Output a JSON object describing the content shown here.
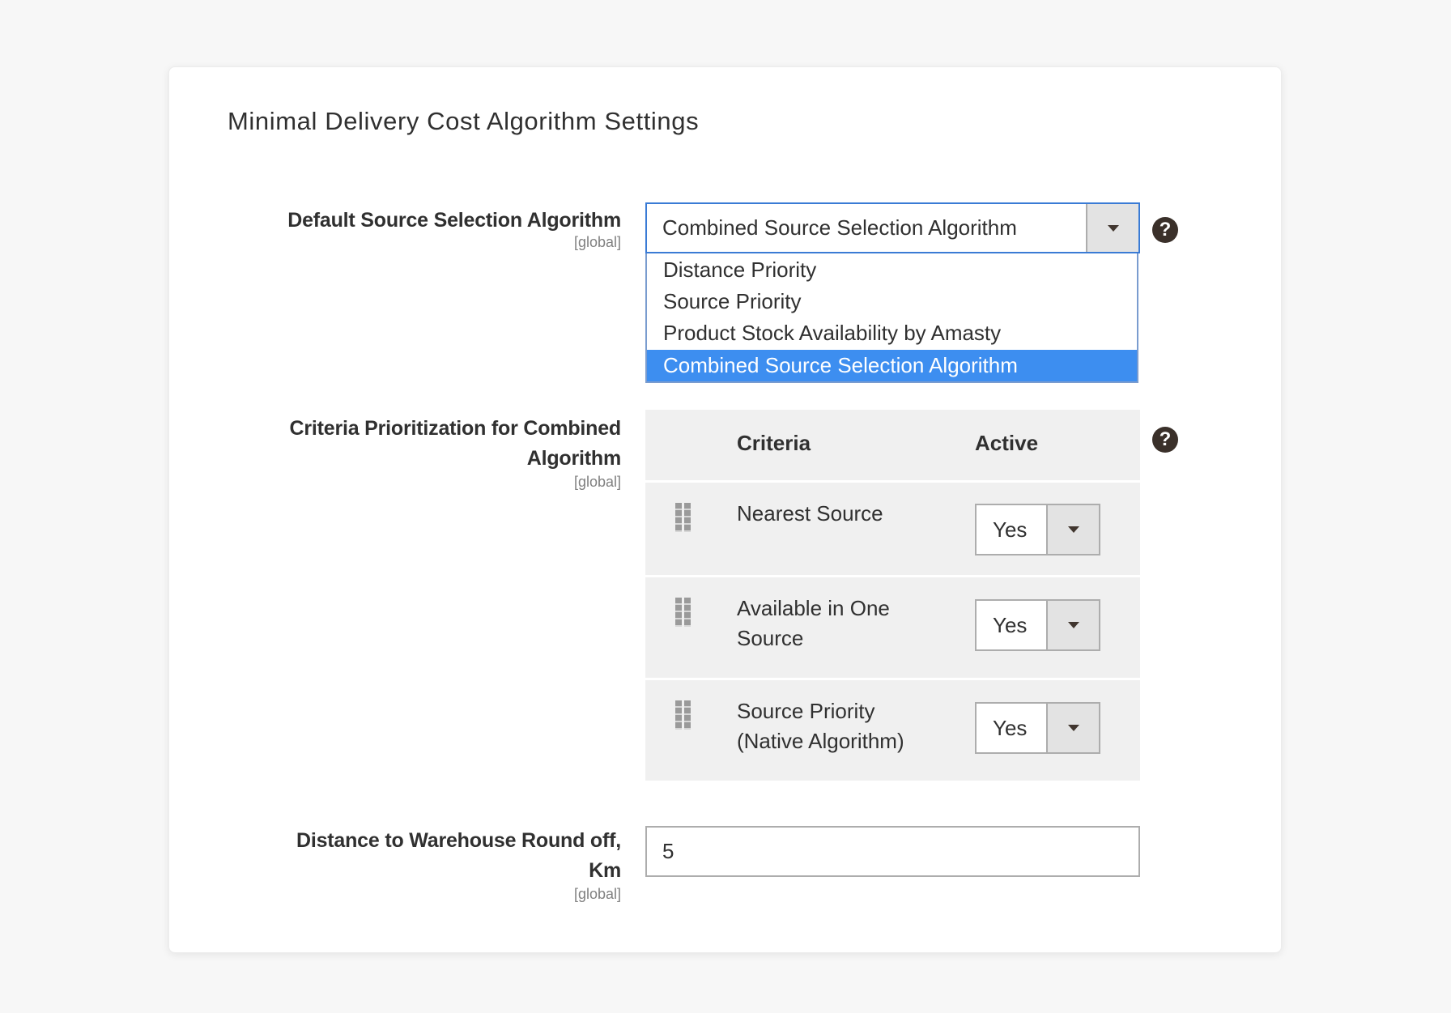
{
  "section": {
    "title": "Minimal Delivery Cost Algorithm Settings"
  },
  "fields": {
    "default_algorithm": {
      "label": "Default Source Selection Algorithm",
      "scope": "[global]",
      "value": "Combined Source Selection Algorithm",
      "options": [
        "Distance Priority",
        "Source Priority",
        "Product Stock Availability by Amasty",
        "Combined Source Selection Algorithm"
      ],
      "selected_index": 3,
      "help_icon": "question-circle-icon"
    },
    "criteria": {
      "label_line1": "Criteria Prioritization for Combined",
      "label_line2": "Algorithm",
      "scope": "[global]",
      "help_icon": "question-circle-icon",
      "columns": [
        "Criteria",
        "Active"
      ],
      "rows": [
        {
          "criteria_line1": "Nearest Source",
          "criteria_line2": "",
          "active": "Yes"
        },
        {
          "criteria_line1": "Available in One",
          "criteria_line2": "Source",
          "active": "Yes"
        },
        {
          "criteria_line1": "Source Priority",
          "criteria_line2": "(Native Algorithm)",
          "active": "Yes"
        }
      ]
    },
    "distance_round": {
      "label_line1": "Distance to Warehouse Round off,",
      "label_line2": "Km",
      "scope": "[global]",
      "value": "5"
    }
  },
  "colors": {
    "page_bg": "#f7f7f7",
    "focus_border": "#3a7bd5",
    "selected_option_bg": "#3d8ef0",
    "table_bg": "#f0f0f0",
    "text": "#303030",
    "scope_text": "#808080"
  }
}
